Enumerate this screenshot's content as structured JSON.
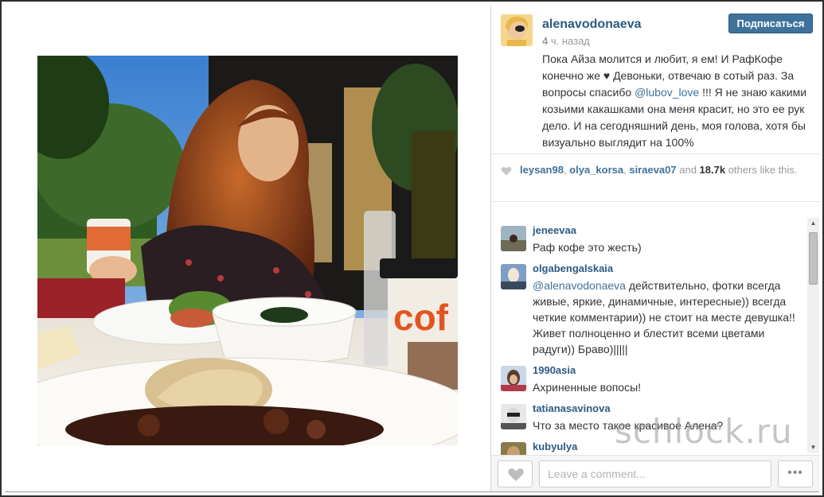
{
  "post": {
    "username": "alenavodonaeva",
    "follow_label": "Подписаться",
    "time_value": "4",
    "time_unit": " ч. назад",
    "caption_part1": "Пока Айза молится и любит, я ем! И РафКофе конечно же ♥ Девоньки, отвечаю в сотый раз. За вопросы спасибо ",
    "caption_mention": "@lubov_love",
    "caption_part2": " !!! Я не знаю какими козьими какашками она меня красит, но это ее рук дело. И на сегодняшний день, моя голова, хотя бы визуально выглядит на 100%"
  },
  "likes": {
    "user1": "leysan98",
    "user2": "olya_korsa",
    "user3": "siraeva07",
    "and": " and ",
    "count": "18.7k",
    "suffix": " others like this."
  },
  "comments": [
    {
      "user": "jeneevaa",
      "text": "Раф кофе это жесть)"
    },
    {
      "user": "olgabengalskaia",
      "mention": "@alenavodonaeva",
      "text": " действительно, фотки всегда живые, яркие, динамичные, интересные)) всегда четкие комментарии)) не стоит на месте девушка!! Живет полноценно и блестит всеми цветами радуги)) Браво)|||||"
    },
    {
      "user": "1990asia",
      "text": "Ахриненные вопосы!"
    },
    {
      "user": "tatianasavinova",
      "text": "Что за место такое красивое Алена?"
    },
    {
      "user": "kubyulya",
      "text": ""
    }
  ],
  "footer": {
    "comment_placeholder": "Leave a comment...",
    "more_label": "•••"
  },
  "watermark": "schlock.ru",
  "colors": {
    "link": "#3f729b",
    "follow_button": "#3f729b",
    "muted": "#999999"
  }
}
